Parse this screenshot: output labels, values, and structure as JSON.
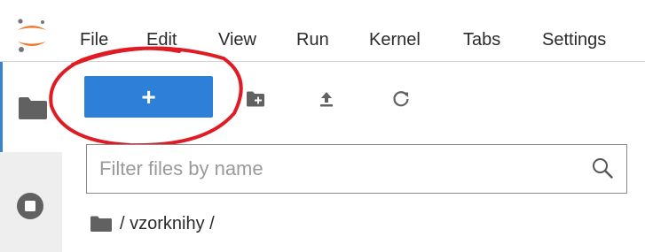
{
  "menu": {
    "items": [
      "File",
      "Edit",
      "View",
      "Run",
      "Kernel",
      "Tabs",
      "Settings"
    ]
  },
  "sidebar": {
    "tabs": [
      {
        "icon": "folder-icon",
        "active": true
      },
      {
        "icon": "stop-circle-icon",
        "active": false
      }
    ]
  },
  "toolbar": {
    "new_launcher_label": "+",
    "icons": [
      "new-folder-icon",
      "upload-icon",
      "refresh-icon"
    ]
  },
  "filter": {
    "placeholder": "Filter files by name",
    "value": ""
  },
  "breadcrumb": {
    "path": "/ vzorknihy /"
  },
  "colors": {
    "accent": "#2d7fd8",
    "logo_orange": "#f37726",
    "annotation_red": "#e01b24",
    "sidebar_bg": "#eeeeee",
    "text": "#2b2b2b"
  }
}
